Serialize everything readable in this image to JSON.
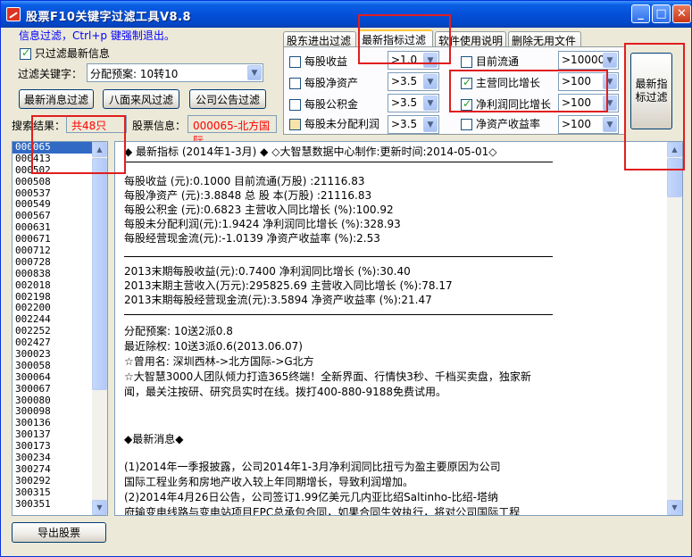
{
  "window": {
    "title": "股票F10关键字过滤工具V8.8",
    "controls": {
      "minimize": "_",
      "maximize": "□",
      "close": "✕"
    }
  },
  "info": {
    "hint": "信息过滤，Ctrl+p 键强制退出。"
  },
  "filter": {
    "only_latest_label": "只过滤最新信息",
    "only_latest_checked": true,
    "keyword_label": "过滤关键字：",
    "keyword_value": "分配预案: 10转10"
  },
  "buttons": {
    "latest_news": "最新消息过滤",
    "all_news": "八面来风过滤",
    "announcement": "公司公告过滤",
    "indicator_filter": "最新指标过滤",
    "export": "导出股票"
  },
  "search": {
    "result_label": "搜索结果：",
    "result_value": "共48只",
    "stock_info_label": "股票信息：",
    "stock_info_value": "000065-北方国际"
  },
  "tabs": [
    {
      "label": "股东进出过滤",
      "active": false
    },
    {
      "label": "最新指标过滤",
      "active": true
    },
    {
      "label": "软件使用说明",
      "active": false
    },
    {
      "label": "删除无用文件",
      "active": false
    }
  ],
  "indicators": [
    {
      "label": "每股收益",
      "checked": false,
      "value": ">1.0"
    },
    {
      "label": "每股净资产",
      "checked": false,
      "value": ">3.5"
    },
    {
      "label": "每股公积金",
      "checked": false,
      "value": ">3.5"
    },
    {
      "label": "每股未分配利润",
      "checked": false,
      "value": ">3.5"
    },
    {
      "label": "目前流通",
      "checked": false,
      "value": ">10000"
    },
    {
      "label": "主营同比增长",
      "checked": true,
      "value": ">100"
    },
    {
      "label": "净利润同比增长",
      "checked": true,
      "value": ">100"
    },
    {
      "label": "净资产收益率",
      "checked": false,
      "value": ">100"
    }
  ],
  "stock_list": [
    "000065",
    "000413",
    "000502",
    "000508",
    "000537",
    "000549",
    "000567",
    "000631",
    "000671",
    "000712",
    "000728",
    "000838",
    "002018",
    "002198",
    "002200",
    "002244",
    "002252",
    "002427",
    "300023",
    "300058",
    "300064",
    "300067",
    "300080",
    "300098",
    "300136",
    "300137",
    "300173",
    "300234",
    "300274",
    "300292",
    "300315",
    "300351"
  ],
  "selected_stock": "000065",
  "detail": {
    "header": "◆  最新指标 (2014年1-3月)  ◆  ◇大智慧数据中心制作:更新时间:2014-05-01◇",
    "lines_a": [
      "每股收益       (元):0.1000             目前流通(万股)      :21116.83",
      "每股净资产     (元):3.8848             总 股 本(万股)      :21116.83",
      "每股公积金     (元):0.6823             主营收入同比增长    (%):100.92",
      "每股未分配利润(元):1.9424              净利润同比增长      (%):328.93",
      "每股经营现金流(元):-1.0139             净资产收益率        (%):2.53"
    ],
    "lines_b": [
      "2013末期每股收益(元):0.7400         净利润同比增长     (%):30.40",
      "2013末期主营收入(万元):295825.69    主营收入同比增长   (%):78.17",
      "2013末期每股经营现金流(元):3.5894   净资产收益率       (%):21.47"
    ],
    "lines_c": [
      "分配预案: 10送2派0.8",
      "最近除权: 10送3派0.6(2013.06.07)",
      "☆曾用名: 深圳西林->北方国际->G北方",
      "☆大智慧3000人团队倾力打造365终端！全新界面、行情快3秒、千档买卖盘，独家新",
      "闻，最关注按研、研究员实时在线。拨打400-880-9188免费试用。"
    ],
    "news_header": "◆最新消息◆",
    "news_lines": [
      "    (1)2014年一季报披露，公司2014年1-3月净利润同比扭亏为盈主要原因为公司",
      "国际工程业务和房地产收入较上年同期增长，导致利润增加。",
      "    (2)2014年4月26日公告，公司签订1.99亿美元几内亚比绍Saltinho-比绍-塔纳",
      "府输变电线路与变电站项目EPC总承包合同，如果合同生效执行，将对公司国际工程"
    ]
  },
  "colors": {
    "title_bar": "#0550d8",
    "highlight_red": "#e01e1e",
    "selection": "#316ac5",
    "info_text": "#0000ff"
  }
}
